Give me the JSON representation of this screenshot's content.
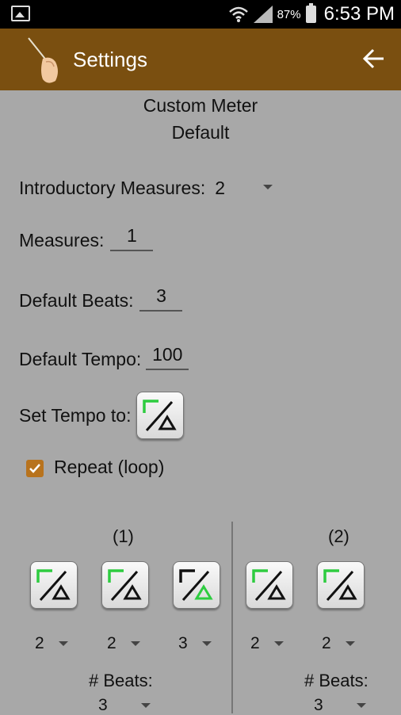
{
  "status": {
    "battery": "87%",
    "time": "6:53 PM"
  },
  "appbar": {
    "title": "Settings"
  },
  "meter": {
    "name": "Custom Meter",
    "preset": "Default"
  },
  "settings": {
    "intro_label": "Introductory Measures:",
    "intro_value": "2",
    "measures_label": "Measures:",
    "measures_value": "1",
    "beats_label": "Default Beats:",
    "beats_value": "3",
    "tempo_label": "Default Tempo:",
    "tempo_value": "100",
    "set_tempo_label": "Set Tempo to:",
    "repeat_label": "Repeat (loop)"
  },
  "measures": [
    {
      "label": "(1)",
      "beat_selects": [
        "2",
        "2",
        "3"
      ],
      "beats_label": "# Beats:",
      "beats_value": "3"
    },
    {
      "label": "(2)",
      "beat_selects": [
        "2",
        "2"
      ],
      "beats_label": "# Beats:",
      "beats_value": "3"
    }
  ],
  "colors": {
    "appbar": "#7a4f10",
    "background": "#a8a8a8",
    "checkbox": "#b8731d",
    "accent_green": "#2ecc40"
  },
  "icons": [
    "image-icon",
    "wifi-icon",
    "signal-icon",
    "battery-icon",
    "conductor-logo-icon",
    "back-arrow-icon",
    "conducting-pattern-icon",
    "check-icon",
    "dropdown-arrow-icon"
  ]
}
